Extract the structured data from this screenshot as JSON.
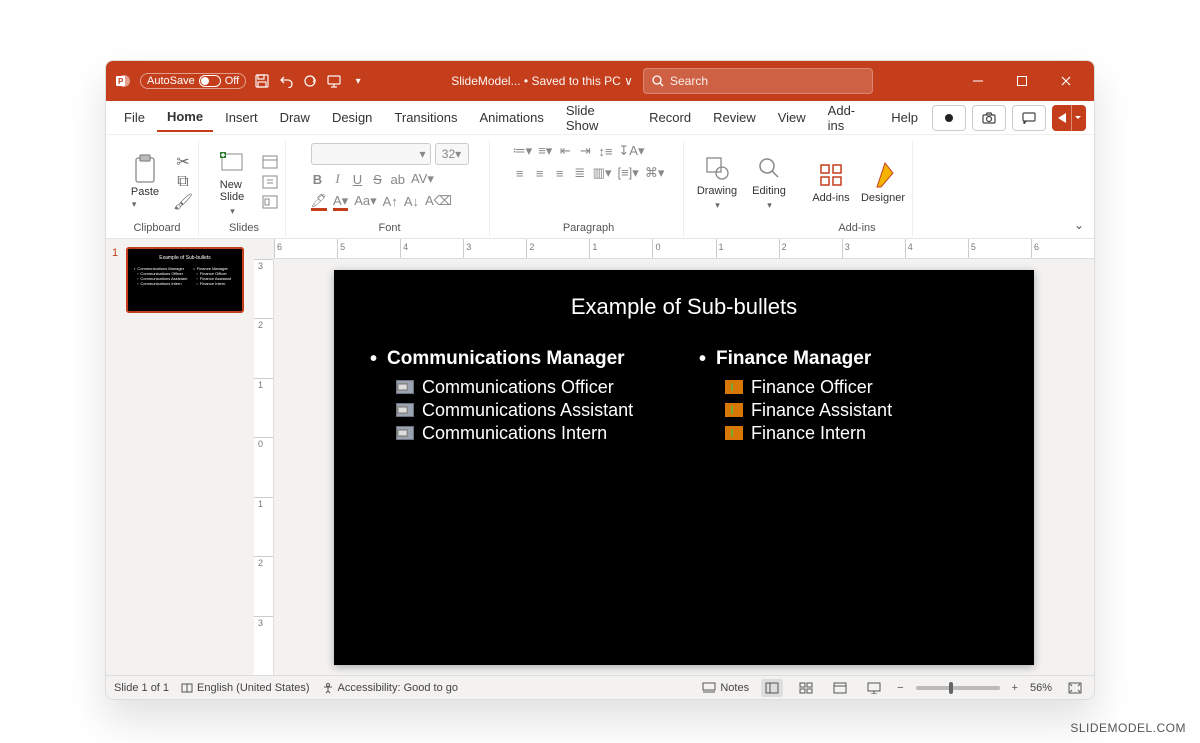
{
  "titlebar": {
    "autosave_label": "AutoSave",
    "autosave_state": "Off",
    "doc_name": "SlideModel...",
    "saved_status": "Saved to this PC",
    "search_placeholder": "Search"
  },
  "menu": {
    "tabs": [
      "File",
      "Home",
      "Insert",
      "Draw",
      "Design",
      "Transitions",
      "Animations",
      "Slide Show",
      "Record",
      "Review",
      "View",
      "Add-ins",
      "Help"
    ],
    "active": "Home"
  },
  "ribbon": {
    "clipboard": {
      "paste": "Paste",
      "label": "Clipboard"
    },
    "slides": {
      "new_slide": "New\nSlide",
      "label": "Slides"
    },
    "font": {
      "size_value": "32",
      "label": "Font"
    },
    "paragraph": {
      "label": "Paragraph"
    },
    "drawing": {
      "label": "Drawing",
      "btn": "Drawing"
    },
    "editing": {
      "btn": "Editing"
    },
    "addins": {
      "btn": "Add-ins",
      "label": "Add-ins"
    },
    "designer": {
      "btn": "Designer"
    }
  },
  "slide": {
    "title": "Example of Sub-bullets",
    "col1": {
      "main": "Communications Manager",
      "subs": [
        "Communications Officer",
        "Communications Assistant",
        "Communications Intern"
      ]
    },
    "col2": {
      "main": "Finance Manager",
      "subs": [
        "Finance Officer",
        "Finance Assistant",
        "Finance Intern"
      ]
    }
  },
  "thumbnails": {
    "slide1_num": "1"
  },
  "statusbar": {
    "slide_count": "Slide 1 of 1",
    "language": "English (United States)",
    "accessibility": "Accessibility: Good to go",
    "notes": "Notes",
    "zoom": "56%"
  },
  "watermark": "SLIDEMODEL.COM"
}
